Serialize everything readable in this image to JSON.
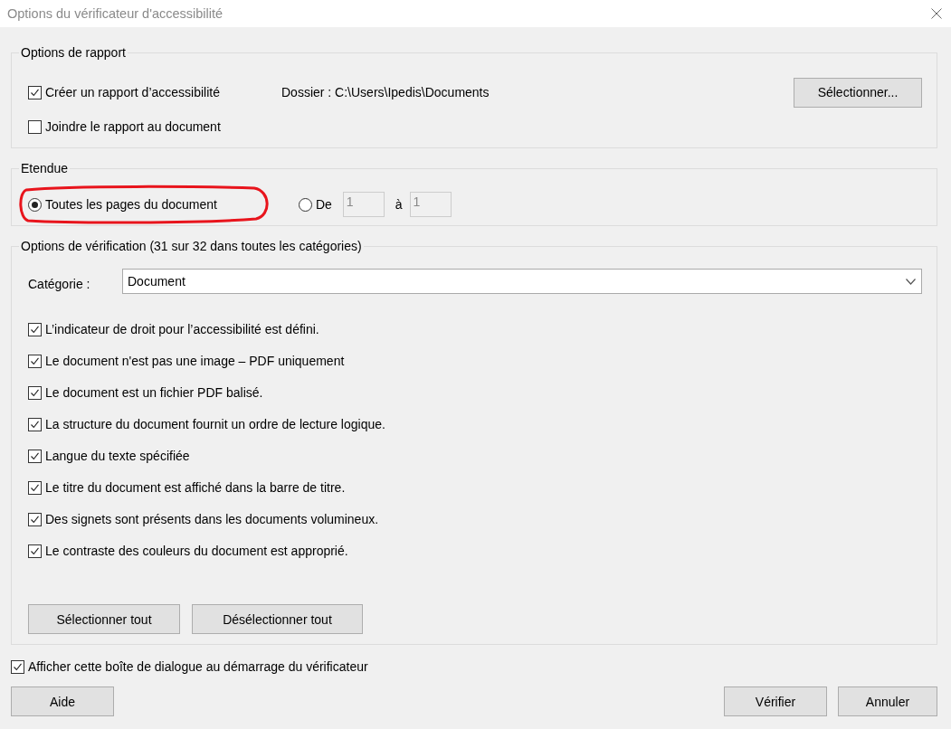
{
  "window": {
    "title": "Options du vérificateur d'accessibilité"
  },
  "report_options": {
    "title": "Options de rapport",
    "create_report": {
      "label": "Créer un rapport d’accessibilité",
      "checked": true
    },
    "folder": "Dossier : C:\\Users\\Ipedis\\Documents",
    "select_button": "Sélectionner...",
    "attach_report": {
      "label": "Joindre le rapport au document",
      "checked": false
    }
  },
  "scope": {
    "title": "Etendue",
    "options": [
      {
        "label": "Toutes les pages du document",
        "selected": true
      },
      {
        "label": "De",
        "selected": false
      }
    ],
    "from": {
      "value": "1",
      "disabled": true
    },
    "to_label": "à",
    "to": {
      "value": "1",
      "disabled": true
    }
  },
  "check_options": {
    "title": "Options de vérification (31 sur 32 dans toutes les catégories)",
    "category_label": "Catégorie :",
    "category": "Document",
    "items": [
      {
        "label": "L’indicateur de droit pour l’accessibilité est défini.",
        "checked": true
      },
      {
        "label": "Le document n'est pas une image – PDF uniquement",
        "checked": true
      },
      {
        "label": "Le document est un fichier PDF balisé.",
        "checked": true
      },
      {
        "label": "La structure du document fournit un ordre de lecture logique.",
        "checked": true
      },
      {
        "label": "Langue du texte spécifiée",
        "checked": true
      },
      {
        "label": "Le titre du document est affiché dans la barre de titre.",
        "checked": true
      },
      {
        "label": "Des signets sont présents dans les documents volumineux.",
        "checked": true
      },
      {
        "label": "Le contraste des couleurs du document est approprié.",
        "checked": true
      }
    ],
    "buttons": [
      "Sélectionner tout",
      "Désélectionner tout"
    ]
  },
  "show_at_startup": {
    "label": "Afficher cette boîte de dialogue au démarrage du vérificateur",
    "checked": true
  },
  "footer": {
    "help": "Aide",
    "actions": [
      "Vérifier",
      "Annuler"
    ]
  }
}
